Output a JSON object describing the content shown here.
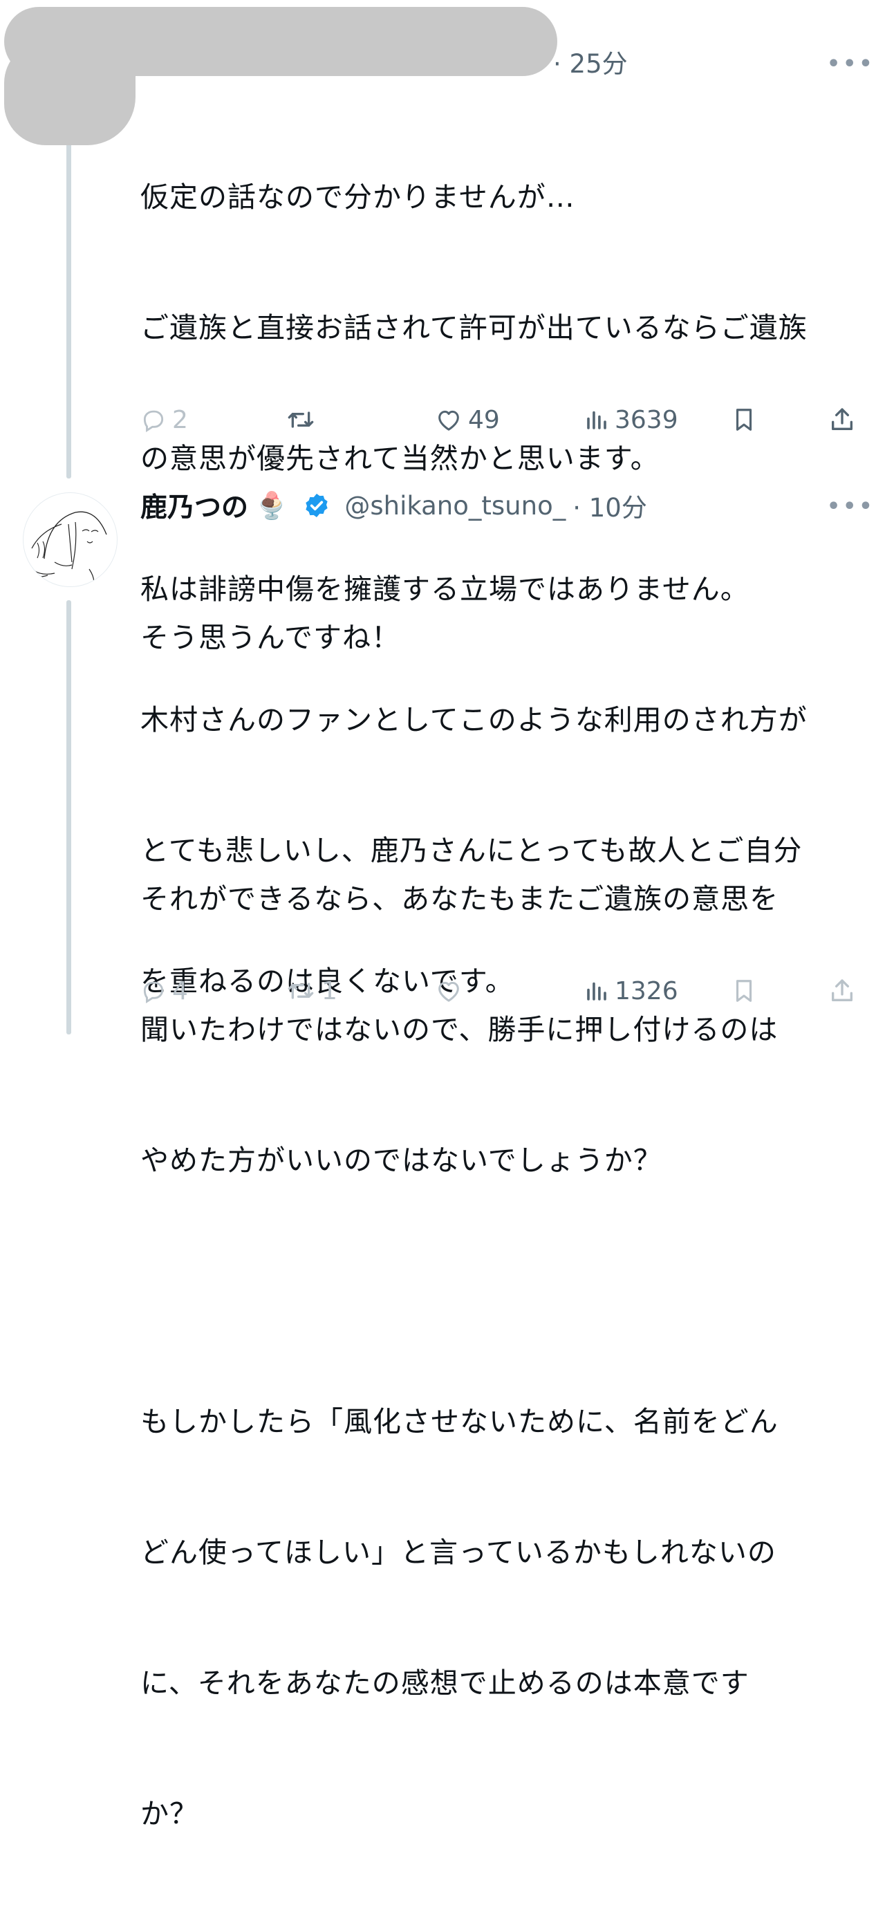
{
  "tweet1": {
    "time": "· 25分",
    "more_label": "•••",
    "lines": [
      "仮定の話なので分かりませんが…",
      "ご遺族と直接お話されて許可が出ているならご遺族",
      "の意思が優先されて当然かと思います。",
      "私は誹謗中傷を擁護する立場ではありません。",
      "木村さんのファンとしてこのような利用のされ方が",
      "とても悲しいし、鹿乃さんにとっても故人とご自分",
      "を重ねるのは良くないです。"
    ],
    "reply_count": "2",
    "retweet_count": "",
    "like_count": "49",
    "view_count": "3639"
  },
  "tweet2": {
    "display_name": "鹿乃つの",
    "emoji": "🍨",
    "handle": "@shikano_tsuno_",
    "time": "· 10分",
    "more_label": "•••",
    "lines": [
      "そう思うんですね！",
      "",
      "それができるなら、あなたもまたご遺族の意思を",
      "聞いたわけではないので、勝手に押し付けるのは",
      "やめた方がいいのではないでしょうか？",
      "",
      "もしかしたら「風化させないために、名前をどん",
      "どん使ってほしい」と言っているかもしれないの",
      "に、それをあなたの感想で止めるのは本意です",
      "か？"
    ],
    "reply_count": "4",
    "retweet_count": "1",
    "like_count": "",
    "view_count": "1326"
  },
  "colors": {
    "text": "#0f1419",
    "secondary": "#536471",
    "faded_icon": "#b9c2c9",
    "verified": "#1d9bf0",
    "thread_line": "#cfd9de",
    "redaction": "#c8c8c8"
  },
  "icons": [
    "reply-icon",
    "retweet-icon",
    "like-icon",
    "views-icon",
    "bookmark-icon",
    "share-icon",
    "verified-badge-icon",
    "more-icon"
  ]
}
